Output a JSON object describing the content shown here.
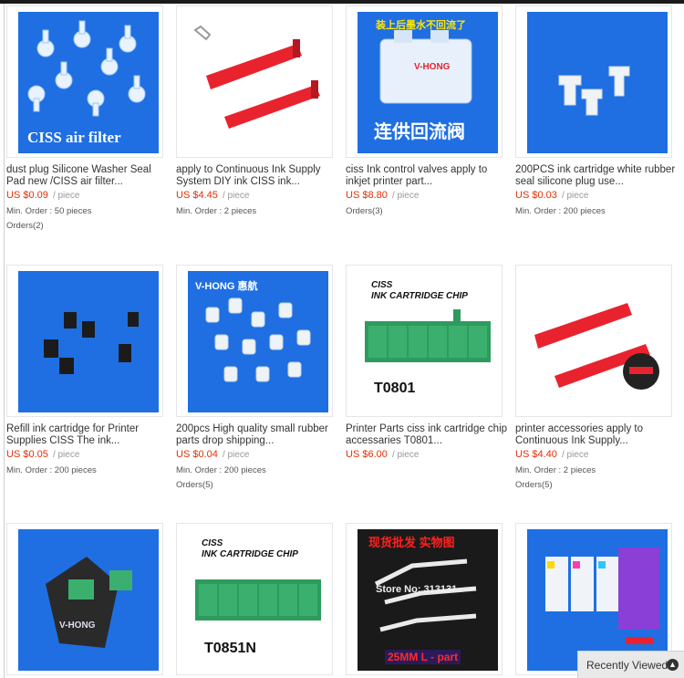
{
  "products": [
    {
      "title": "dust plug Silicone Washer Seal Pad new /CISS air filter...",
      "price": "US $0.09",
      "unit": "/ piece",
      "min_order": "Min. Order : 50 pieces",
      "orders": "Orders(2)",
      "image_text": "CISS air filter"
    },
    {
      "title": "apply to Continuous Ink Supply System DIY ink CISS ink...",
      "price": "US $4.45",
      "unit": "/ piece",
      "min_order": "Min. Order : 2 pieces",
      "orders": "",
      "image_text": ""
    },
    {
      "title": "ciss Ink control valves apply to inkjet printer part...",
      "price": "US $8.80",
      "unit": "/ piece",
      "min_order": "Orders(3)",
      "orders": "",
      "image_text": "装上后墨水不回流了",
      "image_text2": "V-HONG",
      "image_text3": "连供回流阀"
    },
    {
      "title": "200PCS ink cartridge white rubber seal silicone plug use...",
      "price": "US $0.03",
      "unit": "/ piece",
      "min_order": "Min. Order : 200 pieces",
      "orders": "",
      "image_text": ""
    },
    {
      "title": "Refill ink cartridge for Printer Supplies CISS The ink...",
      "price": "US $0.05",
      "unit": "/ piece",
      "min_order": "Min. Order : 200 pieces",
      "orders": "",
      "image_text": ""
    },
    {
      "title": "200pcs High quality small rubber parts drop shipping...",
      "price": "US $0.04",
      "unit": "/ piece",
      "min_order": "Min. Order : 200 pieces",
      "orders": "Orders(5)",
      "image_text": "V-HONG 惠航"
    },
    {
      "title": "Printer Parts ciss ink cartridge chip accessaries T0801...",
      "price": "US $6.00",
      "unit": "/ piece",
      "min_order": "",
      "orders": "",
      "image_text": "CISS",
      "image_text2": "INK CARTRIDGE CHIP",
      "image_text3": "T0801"
    },
    {
      "title": "printer accessories apply to Continuous Ink Supply...",
      "price": "US $4.40",
      "unit": "/ piece",
      "min_order": "Min. Order : 2 pieces",
      "orders": "Orders(5)",
      "image_text": ""
    },
    {
      "title": "",
      "price": "",
      "unit": "",
      "min_order": "",
      "orders": "",
      "image_text": "V-HONG"
    },
    {
      "title": "",
      "price": "",
      "unit": "",
      "min_order": "",
      "orders": "",
      "image_text": "CISS",
      "image_text2": "INK CARTRIDGE CHIP",
      "image_text3": "T0851N"
    },
    {
      "title": "",
      "price": "",
      "unit": "",
      "min_order": "",
      "orders": "",
      "image_text": "现货批发 实物图",
      "image_text2": "Store No: 313131",
      "image_text3": "25MM L - part"
    },
    {
      "title": "",
      "price": "",
      "unit": "",
      "min_order": "",
      "orders": "",
      "image_text": ""
    }
  ],
  "recent": {
    "label": "Recently Viewed"
  },
  "colors": {
    "price": "#e62e04",
    "image_blue": "#1f6fe3",
    "chip_green": "#2e9b5e"
  }
}
